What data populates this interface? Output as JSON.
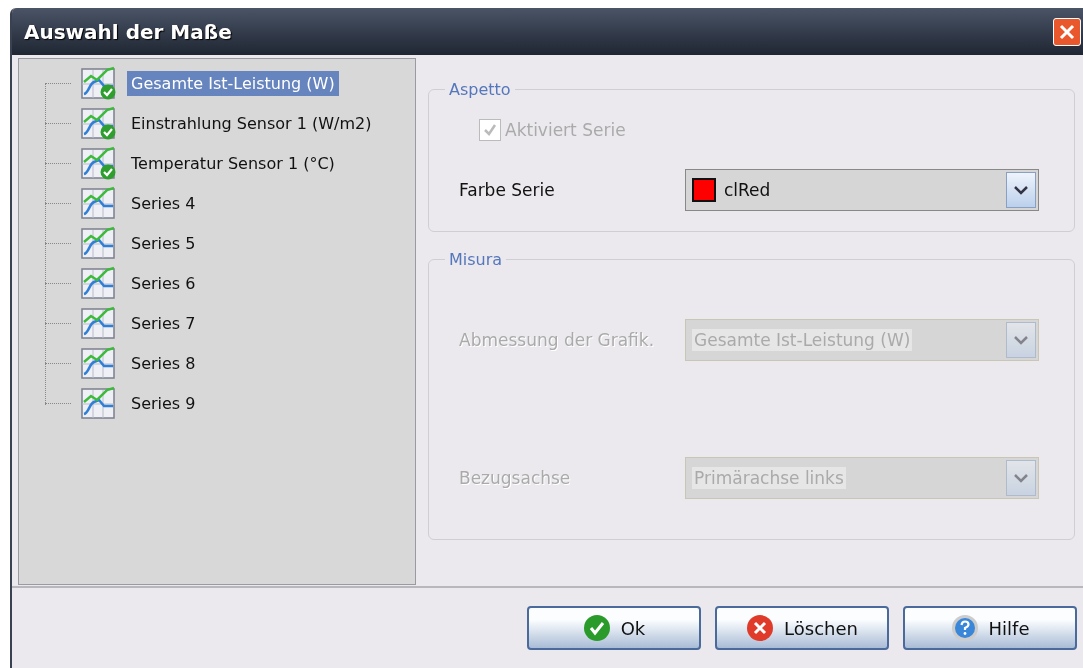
{
  "window": {
    "title": "Auswahl der Maße"
  },
  "tree": {
    "items": [
      {
        "label": "Gesamte Ist-Leistung (W)",
        "selected": true,
        "active": true
      },
      {
        "label": "Einstrahlung Sensor 1 (W/m2)",
        "selected": false,
        "active": true
      },
      {
        "label": "Temperatur Sensor 1 (°C)",
        "selected": false,
        "active": true
      },
      {
        "label": "Series 4",
        "selected": false,
        "active": false
      },
      {
        "label": "Series 5",
        "selected": false,
        "active": false
      },
      {
        "label": "Series 6",
        "selected": false,
        "active": false
      },
      {
        "label": "Series 7",
        "selected": false,
        "active": false
      },
      {
        "label": "Series 8",
        "selected": false,
        "active": false
      },
      {
        "label": "Series 9",
        "selected": false,
        "active": false
      }
    ]
  },
  "aspetto": {
    "title": "Aspetto",
    "checkbox": {
      "label": "Aktiviert Serie",
      "checked": true,
      "disabled": true
    },
    "color_field": {
      "label": "Farbe Serie",
      "value": "clRed",
      "color": "#ff0000"
    }
  },
  "misura": {
    "title": "Misura",
    "disabled": true,
    "fields": [
      {
        "label": "Abmessung der Grafik.",
        "value": "Gesamte Ist-Leistung (W)"
      },
      {
        "label": "Bezugsachse",
        "value": "Primärachse links"
      }
    ]
  },
  "buttons": [
    {
      "label": "Ok",
      "kind": "ok"
    },
    {
      "label": "Löschen",
      "kind": "cancel"
    },
    {
      "label": "Hilfe",
      "kind": "help"
    }
  ]
}
